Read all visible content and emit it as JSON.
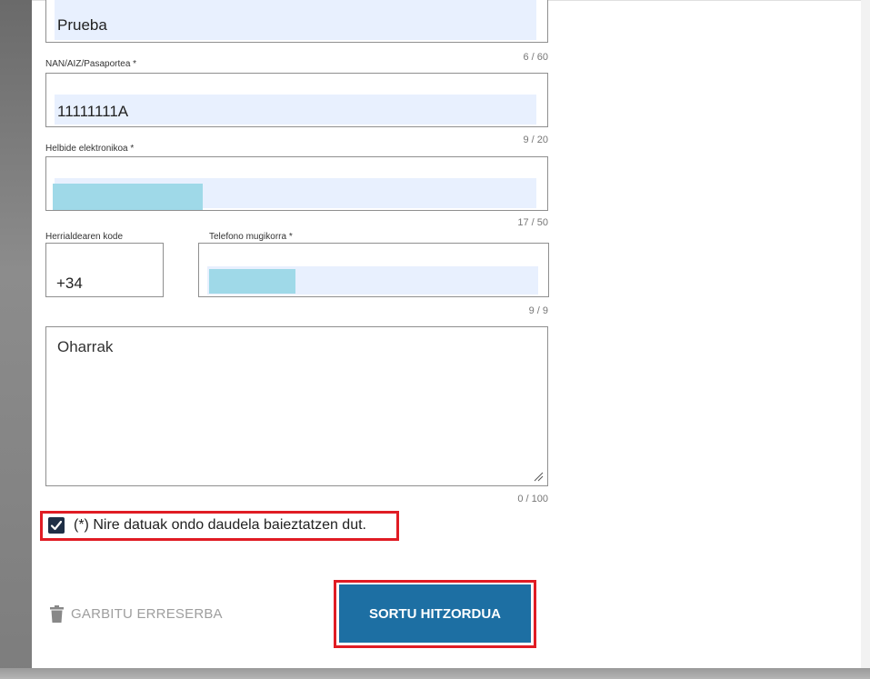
{
  "form": {
    "name": {
      "value": "Prueba",
      "counter": "6 / 60"
    },
    "id_doc": {
      "label": "NAN/AIZ/Pasaportea *",
      "value": "11111111A",
      "counter": "9 / 20"
    },
    "email": {
      "label": "Helbide elektronikoa *",
      "counter": "17 / 50"
    },
    "country_code": {
      "label": "Herrialdearen kode",
      "value": "+34"
    },
    "mobile": {
      "label": "Telefono mugikorra *",
      "counter": "9 / 9"
    },
    "notes": {
      "placeholder": "Oharrak",
      "counter": "0 / 100"
    },
    "confirm": {
      "label": "(*) Nire datuak ondo daudela baieztatzen dut.",
      "checked": true
    }
  },
  "actions": {
    "clear_label": "GARBITU ERRESERBA",
    "create_label": "SORTU HITZORDUA"
  },
  "colors": {
    "primary": "#1d6fa3",
    "highlight": "#e01c24",
    "checkbox": "#1f2f46"
  }
}
